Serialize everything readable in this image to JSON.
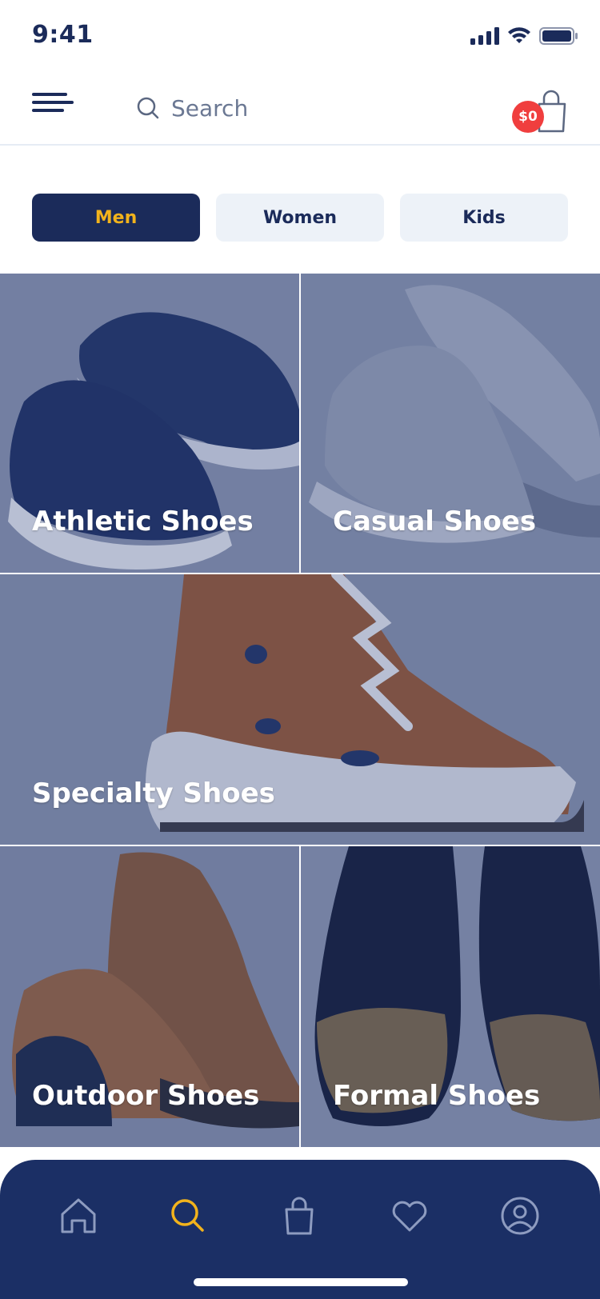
{
  "status_bar": {
    "time": "9:41"
  },
  "header": {
    "search_placeholder": "Search",
    "cart_badge": "$0"
  },
  "tabs": [
    {
      "label": "Men",
      "active": true
    },
    {
      "label": "Women",
      "active": false
    },
    {
      "label": "Kids",
      "active": false
    }
  ],
  "categories": [
    {
      "label": "Athletic Shoes"
    },
    {
      "label": "Casual Shoes"
    },
    {
      "label": "Specialty Shoes"
    },
    {
      "label": "Outdoor Shoes"
    },
    {
      "label": "Formal Shoes"
    }
  ],
  "bottom_nav": [
    {
      "icon": "home-icon",
      "active": false
    },
    {
      "icon": "search-icon",
      "active": true
    },
    {
      "icon": "bag-icon",
      "active": false
    },
    {
      "icon": "heart-icon",
      "active": false
    },
    {
      "icon": "profile-icon",
      "active": false
    }
  ],
  "colors": {
    "navy": "#1b2b5a",
    "accent_yellow": "#f2b31c",
    "badge_red": "#f03e3e",
    "tab_inactive_bg": "#edf2f8"
  }
}
